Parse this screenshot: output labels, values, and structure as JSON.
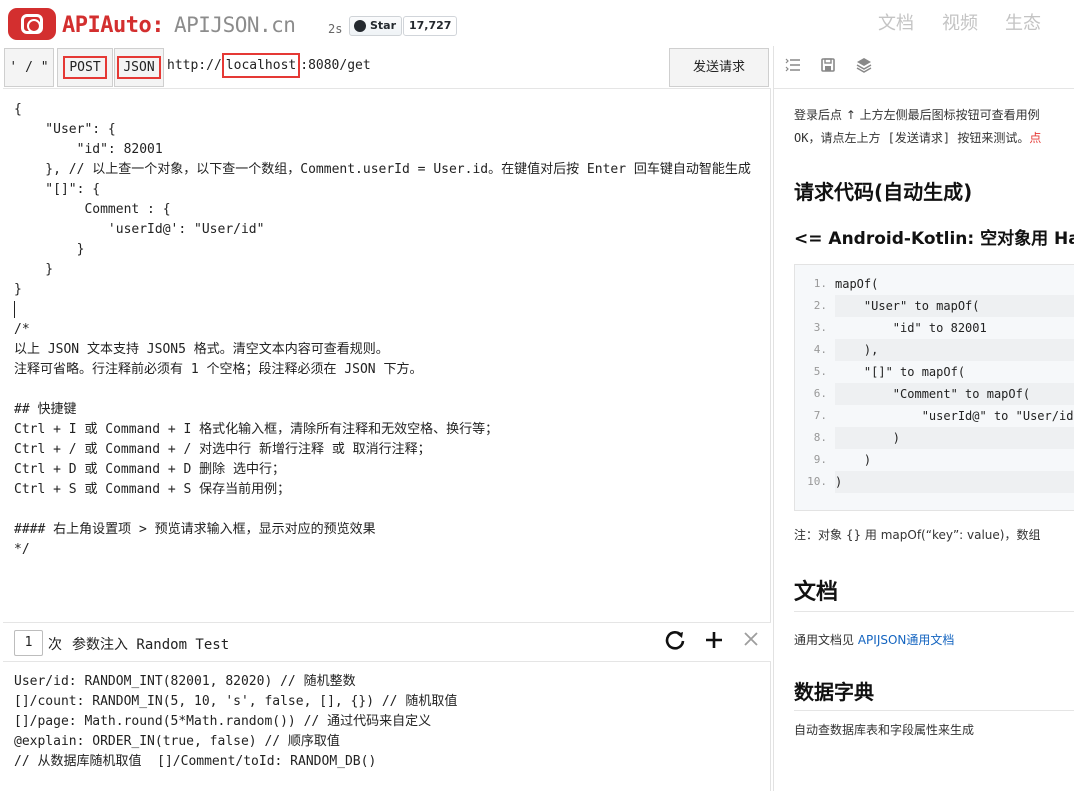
{
  "header": {
    "brand": "APIAuto:",
    "site": "APIJSON.cn",
    "stars_prefix": "2s",
    "star_label": "Star",
    "star_count": "17,727",
    "nav": [
      "文档",
      "视频",
      "生态"
    ]
  },
  "toolbar": {
    "quote_label": "' / \"",
    "method_label": "POST",
    "type_label": "JSON",
    "url_prefix": "http://",
    "url_host": "localhost",
    "url_suffix": ":8080/get",
    "send_label": "发送请求"
  },
  "editor": {
    "lines": [
      "{",
      "    \"User\": {",
      "        \"id\": 82001",
      "    }, // 以上查一个对象，以下查一个数组，Comment.userId = User.id。在键值对后按 Enter 回车键自动智能生成",
      "    \"[]\": {",
      "         Comment : {",
      "            'userId@': \"User/id\"",
      "        }",
      "    }",
      "}",
      "",
      "/*",
      "以上 JSON 文本支持 JSON5 格式。清空文本内容可查看规则。",
      "注释可省略。行注释前必须有 1 个空格；段注释必须在 JSON 下方。",
      "",
      "## 快捷键",
      "Ctrl + I 或 Command + I 格式化输入框，清除所有注释和无效空格、换行等；",
      "Ctrl + / 或 Command + / 对选中行 新增行注释 或 取消行注释；",
      "Ctrl + D 或 Command + D 删除 选中行；",
      "Ctrl + S 或 Command + S 保存当前用例；",
      "",
      "#### 右上角设置项 > 预览请求输入框，显示对应的预览效果",
      "*/"
    ]
  },
  "random_bar": {
    "count_value": "1",
    "times_label": "次",
    "title": "参数注入 Random Test",
    "refresh_icon": "refresh-icon",
    "add_icon": "plus-icon",
    "close_icon": "close-icon"
  },
  "random_code": {
    "lines": [
      "User/id: RANDOM_INT(82001, 82020) // 随机整数",
      "[]/count: RANDOM_IN(5, 10, 's', false, [], {}) // 随机取值",
      "[]/page: Math.round(5*Math.random()) // 通过代码来自定义",
      "@explain: ORDER_IN(true, false) // 顺序取值",
      "// 从数据库随机取值  []/Comment/toId: RANDOM_DB()"
    ]
  },
  "docs": {
    "tool_icons": [
      "list-icon",
      "save-icon",
      "layers-icon"
    ],
    "intro_line1": "登录后点 ↑ 上方左侧最后图标按钮可查看用例",
    "intro_line2_a": "OK，请点左上方 [发送请求] 按钮来测试。",
    "intro_line2_b": "点",
    "codegen_title": "请求代码(自动生成)",
    "codegen_subtitle": "<= Android-Kotlin: 空对象用 HashMap",
    "code_lines": [
      {
        "n": "1.",
        "t": "mapOf("
      },
      {
        "n": "2.",
        "t": "    \"User\" to mapOf("
      },
      {
        "n": "3.",
        "t": "        \"id\" to 82001"
      },
      {
        "n": "4.",
        "t": "    ),"
      },
      {
        "n": "5.",
        "t": "    \"[]\" to mapOf("
      },
      {
        "n": "6.",
        "t": "        \"Comment\" to mapOf("
      },
      {
        "n": "7.",
        "t": "            \"userId@\" to \"User/id\""
      },
      {
        "n": "8.",
        "t": "        )"
      },
      {
        "n": "9.",
        "t": "    )"
      },
      {
        "n": "10.",
        "t": ")"
      }
    ],
    "note": "注：对象 {} 用 mapOf(“key”: value)，数组",
    "docs_title": "文档",
    "docs_text": "通用文档见 ",
    "docs_link": "APIJSON通用文档",
    "dict_title": "数据字典",
    "dict_text": "自动查数据库表和字段属性来生成"
  }
}
